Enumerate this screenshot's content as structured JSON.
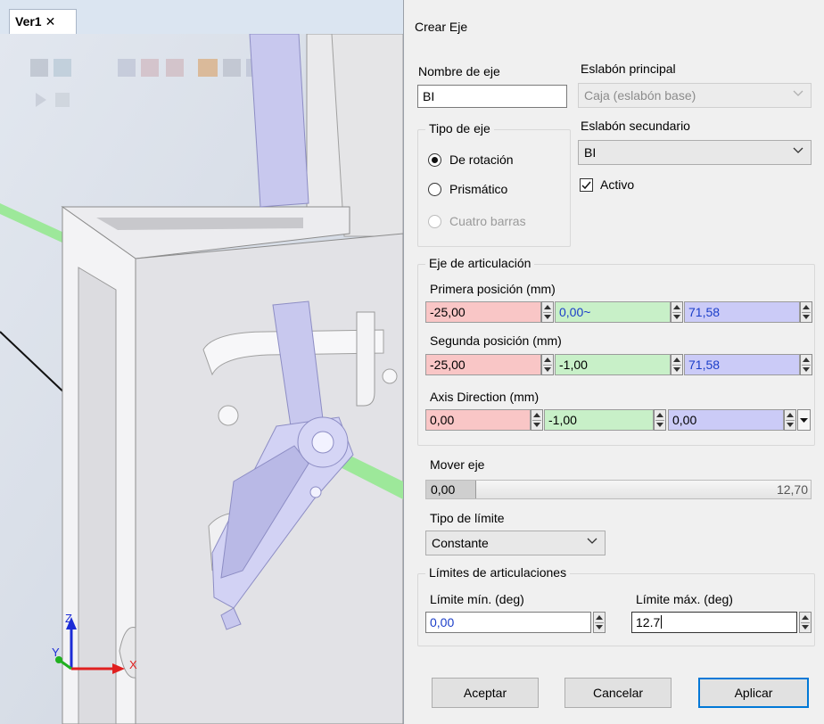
{
  "viewport": {
    "tab_label": "Ver1",
    "tab_close": "✕",
    "axis_labels": {
      "z": "Z",
      "y": "Y",
      "x": "X"
    }
  },
  "dialog": {
    "title": "Crear Eje",
    "axis_name": {
      "label": "Nombre de eje",
      "value": "BI"
    },
    "parent_link": {
      "label": "Eslabón principal",
      "value": "Caja (eslabón base)"
    },
    "child_link": {
      "label": "Eslabón secundario",
      "value": "BI"
    },
    "active": {
      "label": "Activo",
      "checked": true
    },
    "axis_type": {
      "title": "Tipo de eje",
      "options": [
        {
          "label": "De rotación",
          "selected": true,
          "enabled": true
        },
        {
          "label": "Prismático",
          "selected": false,
          "enabled": true
        },
        {
          "label": "Cuatro barras",
          "selected": false,
          "enabled": false
        }
      ]
    },
    "joint_axis": {
      "title": "Eje de articulación",
      "first_position": {
        "label": "Primera posición (mm)",
        "x": "-25,00",
        "y": "0,00~",
        "z": "71,58"
      },
      "second_position": {
        "label": "Segunda posición (mm)",
        "x": "-25,00",
        "y": "-1,00",
        "z": "71,58"
      },
      "direction": {
        "label": "Axis Direction (mm)",
        "x": "0,00",
        "y": "-1,00",
        "z": "0,00"
      }
    },
    "move_axis": {
      "label": "Mover eje",
      "value": "0,00",
      "max": "12,70"
    },
    "limit_type": {
      "label": "Tipo de límite",
      "value": "Constante"
    },
    "joint_limits": {
      "title": "Límites de articulaciones",
      "min": {
        "label": "Límite mín. (deg)",
        "value": "0,00"
      },
      "max": {
        "label": "Límite máx. (deg)",
        "value": "12.7"
      }
    },
    "buttons": {
      "accept": "Aceptar",
      "cancel": "Cancelar",
      "apply": "Aplicar"
    }
  }
}
